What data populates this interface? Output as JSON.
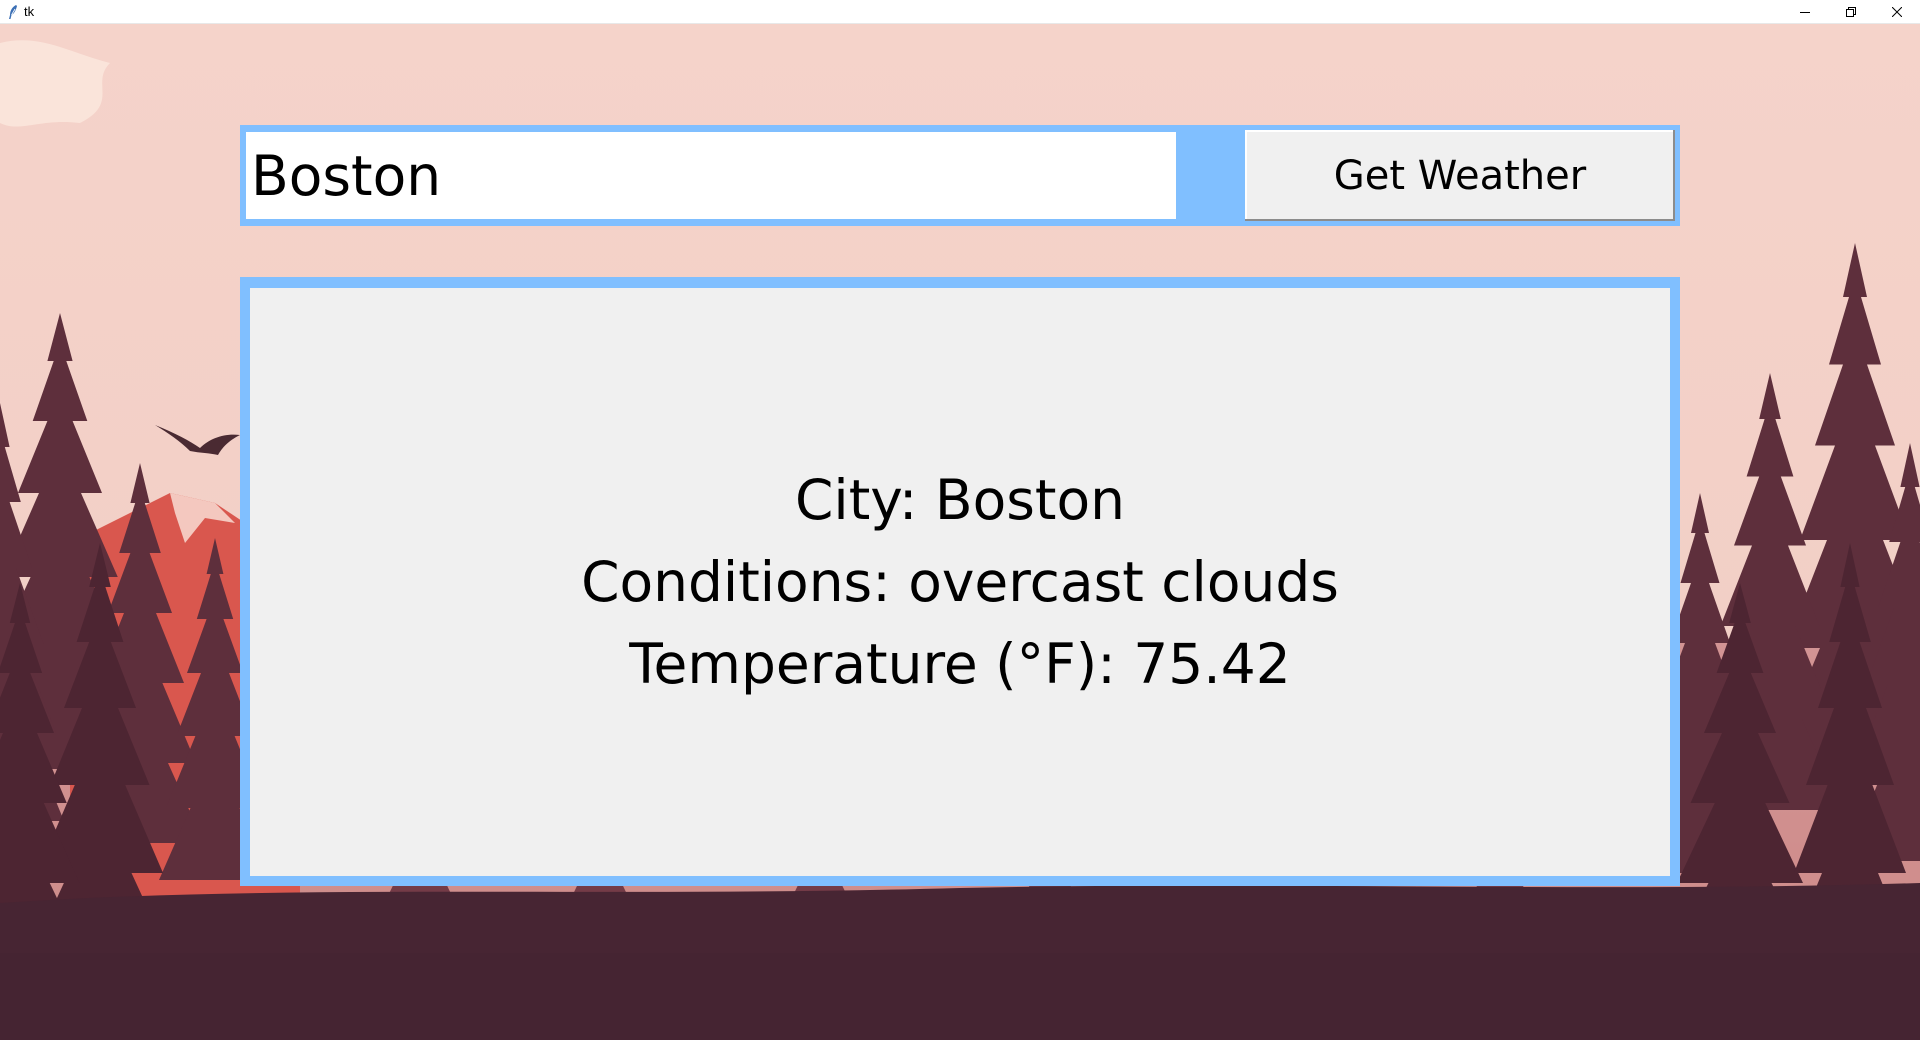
{
  "window": {
    "title": "tk",
    "icon": "tk-feather-icon",
    "controls": [
      "minimize-icon",
      "restore-icon",
      "close-icon"
    ]
  },
  "search": {
    "value": "Boston",
    "button_label": "Get Weather"
  },
  "result": {
    "city_line": "City: Boston",
    "conditions_line": "Conditions: overcast clouds",
    "temperature_line": "Temperature (°F): 75.42"
  },
  "colors": {
    "frame_accent": "#80bfff",
    "panel_background": "#f0f0f0",
    "sky": "#f5d3c9",
    "ground": "#472533",
    "tree_dark": "#5a2d3a",
    "mountain": "#d9574e"
  }
}
